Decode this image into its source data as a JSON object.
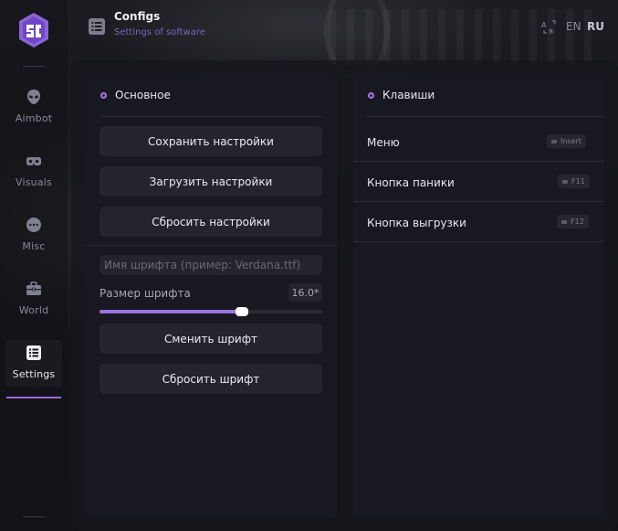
{
  "sidebar": {
    "items": [
      {
        "label": "Aimbot",
        "icon": "alien-icon"
      },
      {
        "label": "Visuals",
        "icon": "vr-headset-icon"
      },
      {
        "label": "Misc",
        "icon": "more-dots-icon"
      },
      {
        "label": "World",
        "icon": "briefcase-icon"
      },
      {
        "label": "Settings",
        "icon": "list-icon",
        "active": true
      }
    ]
  },
  "header": {
    "title": "Configs",
    "subtitle": "Settings of software",
    "lang_en": "EN",
    "lang_ru": "RU"
  },
  "left_panel": {
    "title": "Основное",
    "buttons": {
      "save": "Сохранить настройки",
      "load": "Загрузить настройки",
      "reset": "Сбросить настройки"
    },
    "font_input": {
      "value": "",
      "placeholder": "Имя шрифта (пример: Verdana.ttf)"
    },
    "font_size": {
      "label": "Размер шрифта",
      "value_text": "16.0*",
      "value": 16.0,
      "fill_fraction": 0.64
    },
    "change_font": "Сменить шрифт",
    "reset_font": "Сбросить шрифт"
  },
  "right_panel": {
    "title": "Клавиши",
    "rows": [
      {
        "label": "Меню",
        "key": "Insert"
      },
      {
        "label": "Кнопка паники",
        "key": "F11"
      },
      {
        "label": "Кнопка выгрузки",
        "key": "F12"
      }
    ]
  },
  "colors": {
    "accent": "#9a72e0",
    "subtitle": "#7a68b5"
  }
}
